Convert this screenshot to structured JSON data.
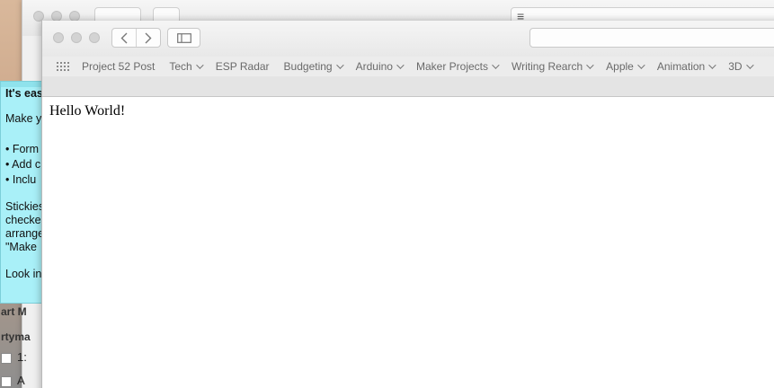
{
  "background_window": {
    "menu_label": "≡",
    "side_texts": [
      "art M",
      "rtyma"
    ],
    "checkbox_rows": [
      "1:",
      "A"
    ]
  },
  "sticky": {
    "lines": [
      "It's eas",
      "Make yo",
      "• Form",
      "• Add c",
      "• Inclu",
      "Stickies",
      "checked",
      "arrange",
      "\"Make",
      "Look in"
    ]
  },
  "toolbar": {
    "back_label": "‹",
    "forward_label": "›",
    "address_value": ""
  },
  "favorites": {
    "items": [
      {
        "label": "Project 52 Post",
        "menu": false
      },
      {
        "label": "Tech",
        "menu": true
      },
      {
        "label": "ESP Radar",
        "menu": false
      },
      {
        "label": "Budgeting",
        "menu": true
      },
      {
        "label": "Arduino",
        "menu": true
      },
      {
        "label": "Maker Projects",
        "menu": true
      },
      {
        "label": "Writing Rearch",
        "menu": true
      },
      {
        "label": "Apple",
        "menu": true
      },
      {
        "label": "Animation",
        "menu": true
      },
      {
        "label": "3D",
        "menu": true
      }
    ]
  },
  "page": {
    "heading": "Hello World!"
  },
  "colors": {
    "sticky_bg": "#a9f0f8",
    "toolbar_bg": "#ececec"
  }
}
